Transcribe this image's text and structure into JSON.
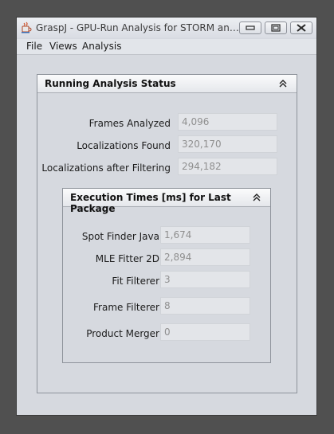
{
  "window": {
    "title": "GraspJ - GPU-Run Analysis for STORM and P...",
    "buttons": {
      "minimize_icon": "minimize-icon",
      "restore_icon": "restore-icon",
      "close_icon": "close-icon"
    }
  },
  "menu": {
    "items": [
      "File",
      "Views",
      "Analysis"
    ]
  },
  "status_panel": {
    "title": "Running Analysis Status",
    "collapse_icon": "double-chevron-up-icon",
    "rows": [
      {
        "label": "Frames Analyzed",
        "value": "4,096"
      },
      {
        "label": "Localizations Found",
        "value": "320,170"
      },
      {
        "label": "Localizations after Filtering",
        "value": "294,182"
      }
    ]
  },
  "exec_panel": {
    "title": "Execution Times [ms] for Last Package",
    "collapse_icon": "double-chevron-up-icon",
    "rows": [
      {
        "label": "Spot Finder Java",
        "value": "1,674"
      },
      {
        "label": "MLE Fitter 2D",
        "value": "2,894"
      },
      {
        "label": "Fit Filterer",
        "value": "3"
      },
      {
        "label": "Frame Filterer",
        "value": "8"
      },
      {
        "label": "Product Merger",
        "value": "0"
      }
    ]
  }
}
